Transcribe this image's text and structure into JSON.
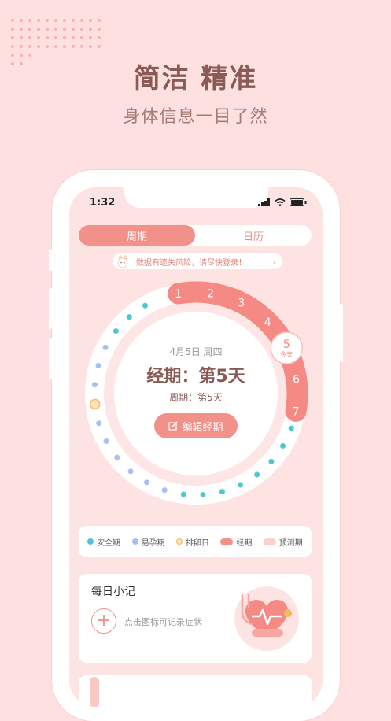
{
  "hero": {
    "title": "简洁 精准",
    "subtitle": "身体信息一目了然"
  },
  "status_bar": {
    "time": "1:32"
  },
  "tabs": [
    {
      "label": "周期",
      "active": true
    },
    {
      "label": "日历",
      "active": false
    }
  ],
  "notice": {
    "text": "数据有遗失风险，请尽快登录！"
  },
  "cycle": {
    "period_days": [
      "1",
      "2",
      "3",
      "4",
      "5",
      "6",
      "7"
    ],
    "today_day": "5",
    "today_label": "今天",
    "date": "4月5日  周四",
    "title": "经期：第5天",
    "subtitle": "周期：第5天"
  },
  "edit_button": {
    "label": "编辑经期"
  },
  "legend": [
    {
      "label": "安全期",
      "color": "#4ec7d2"
    },
    {
      "label": "易孕期",
      "color": "#a9bff2"
    },
    {
      "label": "排卵日",
      "color": "#f6b85c"
    },
    {
      "label": "经期",
      "color": "#f2908a"
    },
    {
      "label": "预测期",
      "color": "#fbd0cd"
    }
  ],
  "daily_note": {
    "title": "每日小记",
    "hint": "点击图标可记录症状"
  },
  "colors": {
    "accent": "#f2908a",
    "background": "#fde0df",
    "title": "#8a5a54"
  }
}
